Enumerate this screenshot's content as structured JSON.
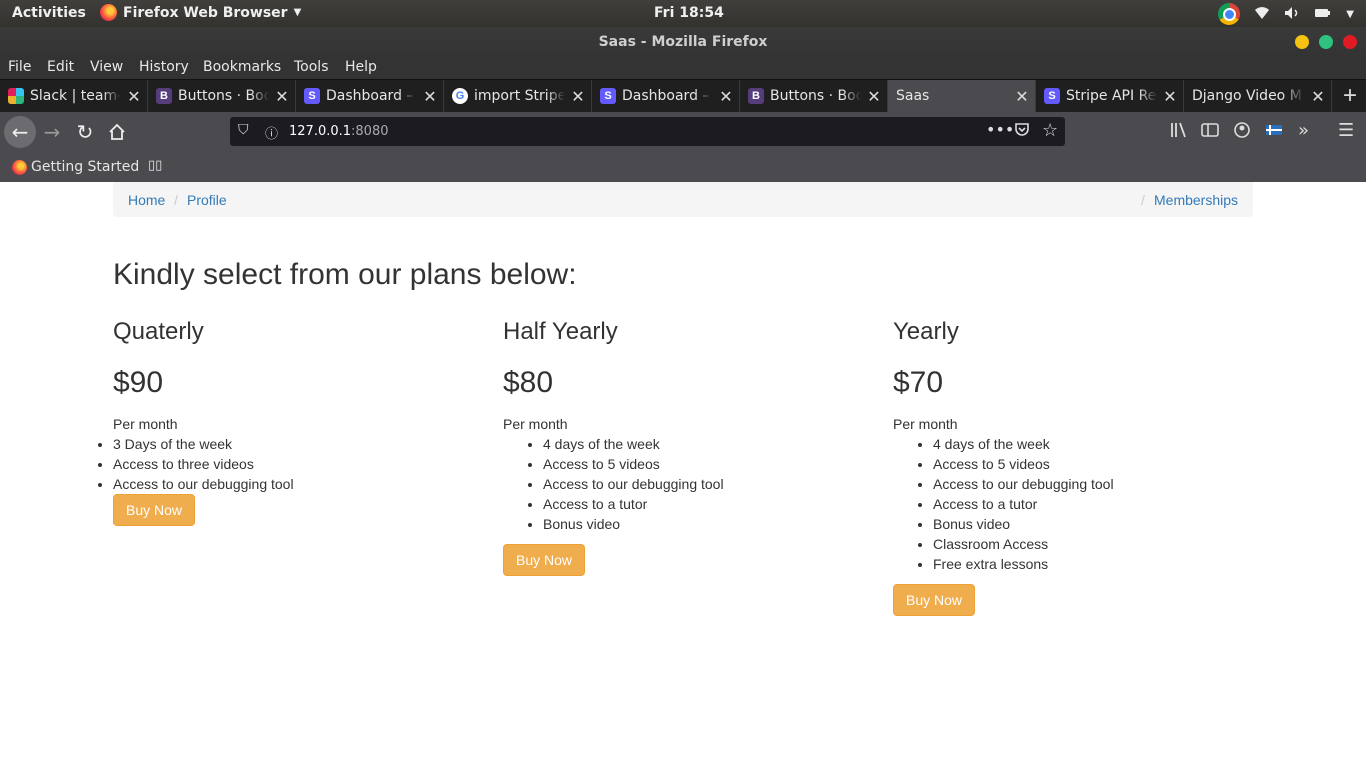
{
  "system": {
    "activities": "Activities",
    "app_name": "Firefox Web Browser",
    "clock": "Fri 18:54"
  },
  "window": {
    "title": "Saas - Mozilla Firefox"
  },
  "menu": [
    "File",
    "Edit",
    "View",
    "History",
    "Bookmarks",
    "Tools",
    "Help"
  ],
  "tabs": [
    {
      "label": "Slack | team-(",
      "icon": "slack-icon"
    },
    {
      "label": "Buttons · Boo",
      "icon": "bootstrap-icon"
    },
    {
      "label": "Dashboard – ",
      "icon": "stripe-icon"
    },
    {
      "label": "import Stripe",
      "icon": "google-icon"
    },
    {
      "label": "Dashboard – ",
      "icon": "stripe-icon"
    },
    {
      "label": "Buttons · Boo",
      "icon": "bootstrap-icon"
    },
    {
      "label": "Saas",
      "icon": "none",
      "active": true
    },
    {
      "label": "Stripe API Re",
      "icon": "stripe-icon"
    },
    {
      "label": "Django Video M",
      "icon": "none"
    }
  ],
  "url": {
    "host": "127.0.0.1",
    "port": ":8080"
  },
  "bookmarks": {
    "getting_started": "Getting Started"
  },
  "page": {
    "breadcrumb": {
      "home": "Home",
      "separator": "/",
      "profile": "Profile",
      "memberships": "Memberships"
    },
    "heading": "Kindly select from our plans below:",
    "plans": [
      {
        "name": "Quaterly",
        "price": "$90",
        "period": "Per month",
        "features": [
          "3 Days of the week",
          "Access to three videos",
          "Access to our debugging tool"
        ],
        "button": "Buy Now"
      },
      {
        "name": "Half Yearly",
        "price": "$80",
        "period": "Per month",
        "features": [
          "4 days of the week",
          "Access to 5 videos",
          "Access to our debugging tool",
          "Access to a tutor",
          "Bonus video"
        ],
        "button": "Buy Now"
      },
      {
        "name": "Yearly",
        "price": "$70",
        "period": "Per month",
        "features": [
          "4 days of the week",
          "Access to 5 videos",
          "Access to our debugging tool",
          "Access to a tutor",
          "Bonus video",
          "Classroom Access",
          "Free extra lessons"
        ],
        "button": "Buy Now"
      }
    ]
  },
  "colors": {
    "link": "#337ab7",
    "button": "#f0ad4e",
    "stripe": "#635bff",
    "bootstrap": "#563d7c"
  }
}
